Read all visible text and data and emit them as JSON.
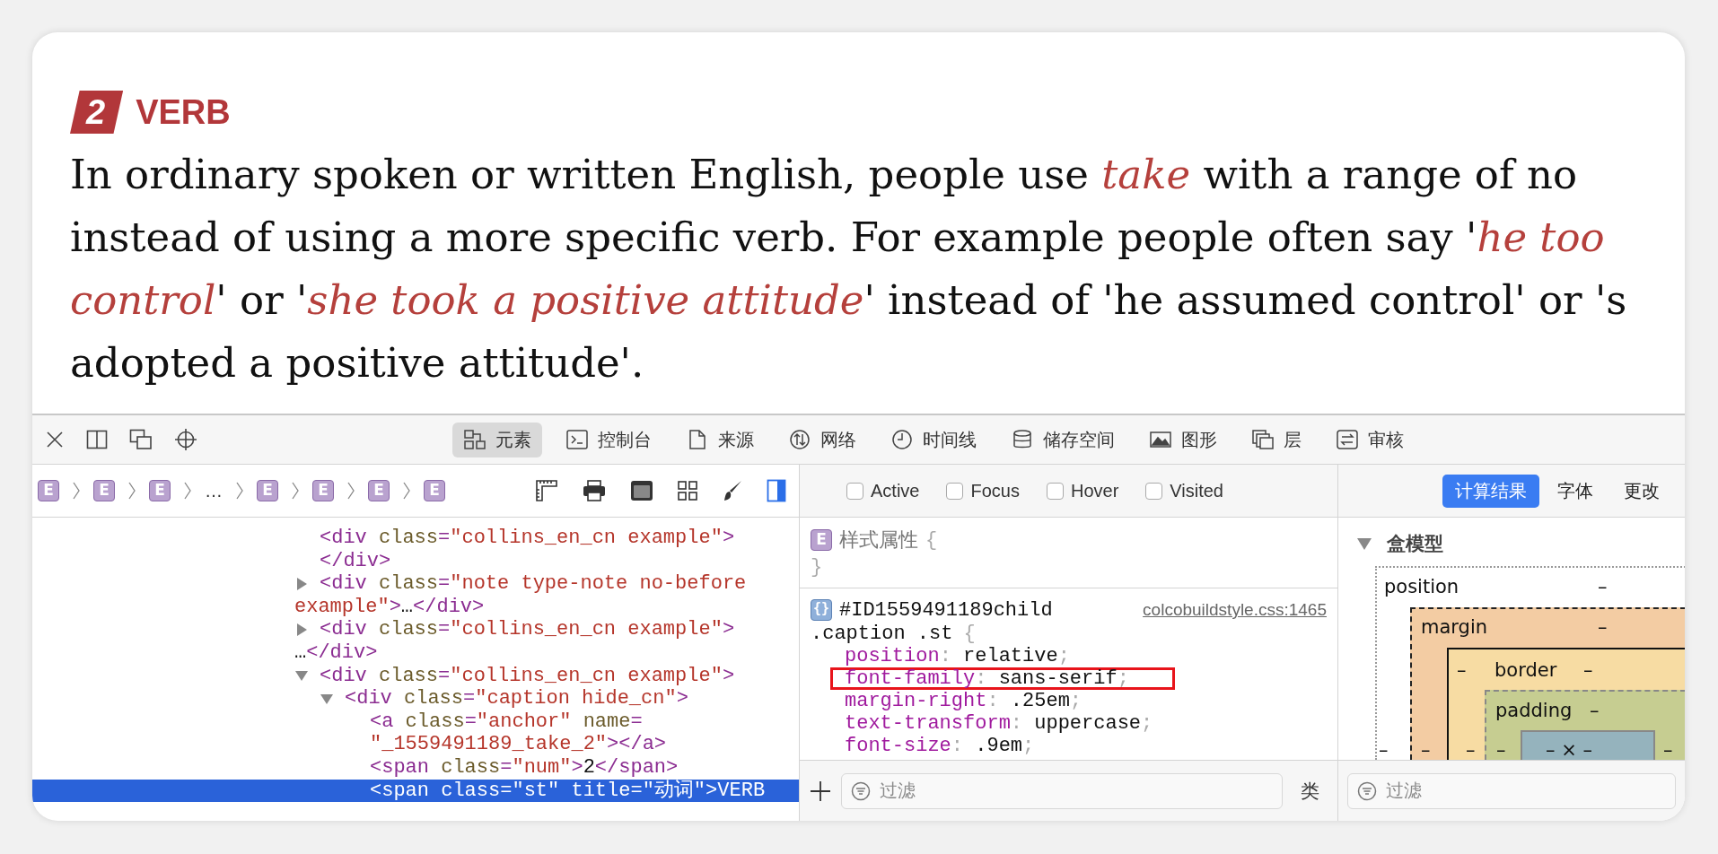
{
  "article": {
    "sense": {
      "number": "2",
      "label": "VERB"
    },
    "lines": [
      "In ordinary spoken or written English, people use *take* with a range of no",
      "instead of using a more specific verb. For example people often say '*he too*",
      "*control*' or '*she took a positive attitude*' instead of 'he assumed control' or 's",
      "adopted a positive attitude'."
    ]
  },
  "devtools": {
    "tabs": [
      {
        "kind": "elements",
        "label": "元素",
        "selected": true
      },
      {
        "kind": "console",
        "label": "控制台",
        "selected": false
      },
      {
        "kind": "sources",
        "label": "来源",
        "selected": false
      },
      {
        "kind": "network",
        "label": "网络",
        "selected": false
      },
      {
        "kind": "timeline",
        "label": "时间线",
        "selected": false
      },
      {
        "kind": "storage",
        "label": "储存空间",
        "selected": false
      },
      {
        "kind": "graphics",
        "label": "图形",
        "selected": false
      },
      {
        "kind": "layers",
        "label": "层",
        "selected": false
      },
      {
        "kind": "audit",
        "label": "审核",
        "selected": false
      }
    ],
    "breadcrumb": [
      {
        "kind": "element",
        "text": "E"
      },
      {
        "kind": "element",
        "text": "E"
      },
      {
        "kind": "element",
        "text": "E"
      },
      {
        "kind": "ellipsis",
        "text": "…"
      },
      {
        "kind": "element",
        "text": "E"
      },
      {
        "kind": "element",
        "text": "E"
      },
      {
        "kind": "element",
        "text": "E"
      },
      {
        "kind": "element",
        "text": "E"
      }
    ],
    "dom_tree": [
      {
        "kind": "leaf",
        "selected": false,
        "lines": [
          [
            {
              "kind": "tag",
              "text": "<div"
            },
            {
              "kind": "attr",
              "text": " class"
            },
            {
              "kind": "tag",
              "text": "="
            },
            {
              "kind": "value",
              "text": "\"collins_en_cn example\""
            },
            {
              "kind": "tag",
              "text": ">"
            }
          ],
          [
            {
              "kind": "tag",
              "text": "</div>"
            }
          ]
        ]
      },
      {
        "kind": "container",
        "expanded": false,
        "selected": false,
        "lines": [
          [
            {
              "kind": "tag",
              "text": "<div"
            },
            {
              "kind": "attr",
              "text": " class"
            },
            {
              "kind": "tag",
              "text": "="
            },
            {
              "kind": "value",
              "text": "\"note type-note no-before"
            }
          ],
          [
            {
              "kind": "value",
              "text": "example\""
            },
            {
              "kind": "tag",
              "text": ">"
            },
            {
              "kind": "text",
              "text": "…"
            },
            {
              "kind": "tag",
              "text": "</div>"
            }
          ]
        ]
      },
      {
        "kind": "container",
        "expanded": false,
        "selected": false,
        "lines": [
          [
            {
              "kind": "tag",
              "text": "<div"
            },
            {
              "kind": "attr",
              "text": " class"
            },
            {
              "kind": "tag",
              "text": "="
            },
            {
              "kind": "value",
              "text": "\"collins_en_cn example\""
            },
            {
              "kind": "tag",
              "text": ">"
            }
          ],
          [
            {
              "kind": "text",
              "text": "…"
            },
            {
              "kind": "tag",
              "text": "</div>"
            }
          ]
        ]
      },
      {
        "kind": "container",
        "expanded": true,
        "selected": false,
        "lines": [
          [
            {
              "kind": "tag",
              "text": "<div"
            },
            {
              "kind": "attr",
              "text": " class"
            },
            {
              "kind": "tag",
              "text": "="
            },
            {
              "kind": "value",
              "text": "\"collins_en_cn example\""
            },
            {
              "kind": "tag",
              "text": ">"
            }
          ]
        ],
        "children": [
          {
            "kind": "container",
            "expanded": true,
            "selected": false,
            "lines": [
              [
                {
                  "kind": "tag",
                  "text": "<div"
                },
                {
                  "kind": "attr",
                  "text": " class"
                },
                {
                  "kind": "tag",
                  "text": "="
                },
                {
                  "kind": "value",
                  "text": "\"caption hide_cn\""
                },
                {
                  "kind": "tag",
                  "text": ">"
                }
              ]
            ],
            "children": [
              {
                "kind": "leaf",
                "selected": false,
                "lines": [
                  [
                    {
                      "kind": "tag",
                      "text": "<a"
                    },
                    {
                      "kind": "attr",
                      "text": " class"
                    },
                    {
                      "kind": "tag",
                      "text": "="
                    },
                    {
                      "kind": "value",
                      "text": "\"anchor\""
                    },
                    {
                      "kind": "attr",
                      "text": " name"
                    },
                    {
                      "kind": "tag",
                      "text": "="
                    }
                  ],
                  [
                    {
                      "kind": "value",
                      "text": "\"_1559491189_take_2\""
                    },
                    {
                      "kind": "tag",
                      "text": "></a>"
                    }
                  ]
                ]
              },
              {
                "kind": "leaf",
                "selected": false,
                "lines": [
                  [
                    {
                      "kind": "tag",
                      "text": "<span"
                    },
                    {
                      "kind": "attr",
                      "text": " class"
                    },
                    {
                      "kind": "tag",
                      "text": "="
                    },
                    {
                      "kind": "value",
                      "text": "\"num\""
                    },
                    {
                      "kind": "tag",
                      "text": ">"
                    },
                    {
                      "kind": "text",
                      "text": "2"
                    },
                    {
                      "kind": "tag",
                      "text": "</span>"
                    }
                  ]
                ]
              },
              {
                "kind": "leaf",
                "selected": true,
                "lines": [
                  [
                    {
                      "kind": "tag",
                      "text": "<span"
                    },
                    {
                      "kind": "attr",
                      "text": " class"
                    },
                    {
                      "kind": "tag",
                      "text": "="
                    },
                    {
                      "kind": "value",
                      "text": "\"st\""
                    },
                    {
                      "kind": "attr",
                      "text": " title"
                    },
                    {
                      "kind": "tag",
                      "text": "="
                    },
                    {
                      "kind": "value",
                      "text": "\"动词\""
                    },
                    {
                      "kind": "tag",
                      "text": ">"
                    },
                    {
                      "kind": "text",
                      "text": "VERB"
                    }
                  ]
                ]
              }
            ]
          }
        ]
      }
    ],
    "styles": {
      "pseudo_classes": [
        {
          "label": "Active",
          "checked": false
        },
        {
          "label": "Focus",
          "checked": false
        },
        {
          "label": "Hover",
          "checked": false
        },
        {
          "label": "Visited",
          "checked": false
        }
      ],
      "inline": {
        "badge": "E",
        "label": "样式属性",
        "open": "{",
        "close": "}"
      },
      "rule": {
        "badge": "{}",
        "selectors": [
          "#ID1559491189child",
          ".caption .st"
        ],
        "open": "{",
        "source": "colcobuildstyle.css:1465",
        "properties": [
          {
            "name": "position",
            "separator": ":",
            "value": "relative",
            "terminator": ";",
            "highlighted": false
          },
          {
            "name": "font-family",
            "separator": ":",
            "value": "sans-serif",
            "terminator": ";",
            "highlighted": true
          },
          {
            "name": "margin-right",
            "separator": ":",
            "value": ".25em",
            "terminator": ";",
            "highlighted": false
          },
          {
            "name": "text-transform",
            "separator": ":",
            "value": "uppercase",
            "terminator": ";",
            "highlighted": false
          },
          {
            "name": "font-size",
            "separator": ":",
            "value": ".9em",
            "terminator": ";",
            "highlighted": false
          }
        ]
      },
      "filter": {
        "placeholder": "过滤"
      },
      "class_button": "类"
    },
    "computed": {
      "tabs": [
        {
          "label": "计算结果",
          "selected": true
        },
        {
          "label": "字体",
          "selected": false
        },
        {
          "label": "更改",
          "selected": false
        }
      ],
      "box_model": {
        "title": "盒模型",
        "expanded": true,
        "layers": [
          {
            "kind": "position",
            "label": "position",
            "top": "–",
            "left": "–"
          },
          {
            "kind": "margin",
            "label": "margin",
            "top": "–",
            "left": "–"
          },
          {
            "kind": "border",
            "label": "border",
            "before_label": "–",
            "top": "–",
            "left": "–"
          },
          {
            "kind": "padding",
            "label": "padding",
            "top": "–",
            "left": "–",
            "right": "–"
          }
        ],
        "content": "– × –"
      },
      "filter": {
        "placeholder": "过滤"
      }
    }
  }
}
